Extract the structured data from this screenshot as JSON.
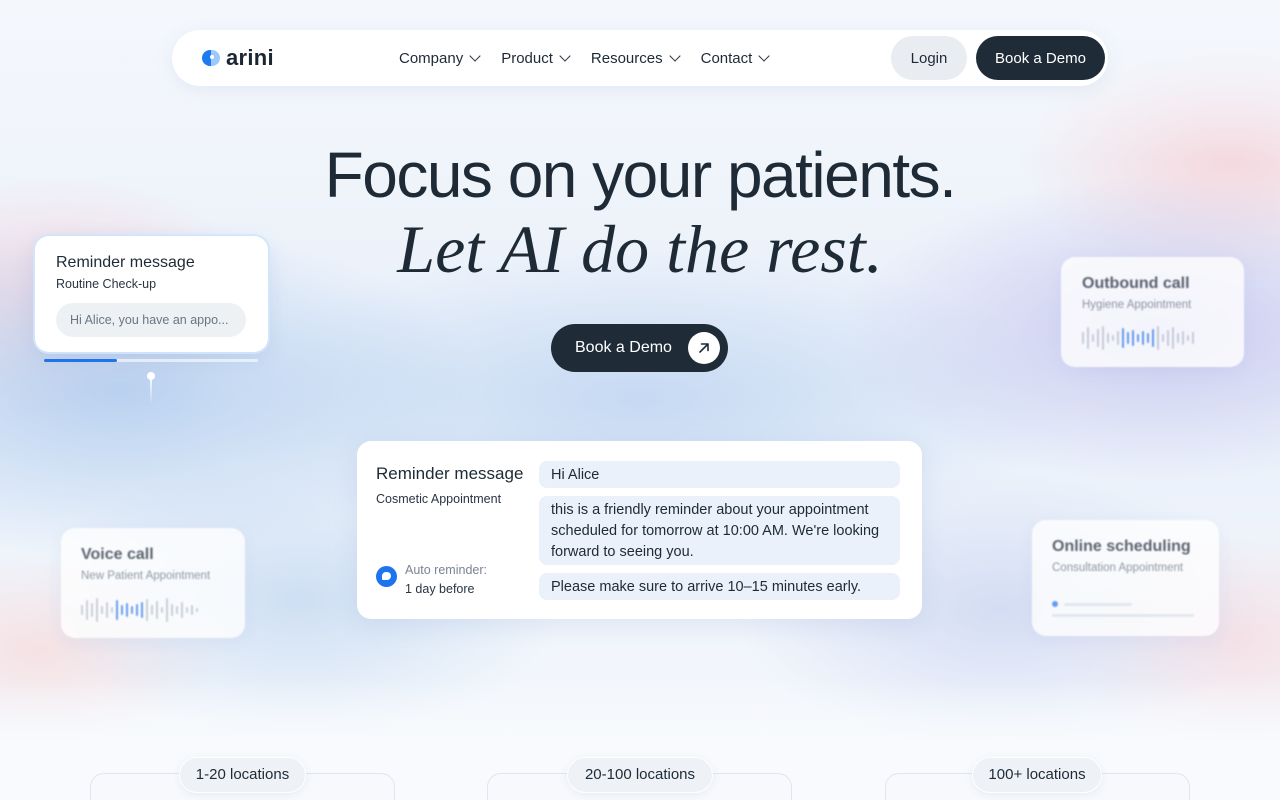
{
  "brand": {
    "name": "arini"
  },
  "nav": {
    "items": [
      {
        "label": "Company"
      },
      {
        "label": "Product"
      },
      {
        "label": "Resources"
      },
      {
        "label": "Contact"
      }
    ],
    "login_label": "Login",
    "demo_label": "Book a Demo"
  },
  "hero": {
    "headline": "Focus on your patients.",
    "subheadline": "Let AI do the rest.",
    "cta_label": "Book a Demo",
    "cta_icon": "arrow-up-right-icon"
  },
  "cards": {
    "reminder_left": {
      "title": "Reminder message",
      "subtitle": "Routine Check-up",
      "preview": "Hi Alice, you have an appo...",
      "progress": 0.34
    },
    "voice_call": {
      "title": "Voice call",
      "subtitle": "New Patient Appointment"
    },
    "outbound_call": {
      "title": "Outbound call",
      "subtitle": "Hygiene Appointment"
    },
    "online_scheduling": {
      "title": "Online scheduling",
      "subtitle": "Consultation Appointment"
    },
    "reminder_main": {
      "title": "Reminder message",
      "subtitle": "Cosmetic Appointment",
      "auto_label": "Auto reminder:",
      "auto_value": "1 day before",
      "messages": [
        "Hi Alice",
        "this is a friendly reminder about your appointment scheduled for tomorrow at 10:00 AM. We're looking forward to seeing you.",
        "Please make sure to arrive 10–15 minutes early."
      ]
    }
  },
  "locations": [
    {
      "label": "1-20 locations"
    },
    {
      "label": "20-100 locations"
    },
    {
      "label": "100+ locations"
    }
  ],
  "colors": {
    "accent": "#1d74ee",
    "dark_button": "#1f2c38",
    "bubble": "#eaf1fb"
  }
}
